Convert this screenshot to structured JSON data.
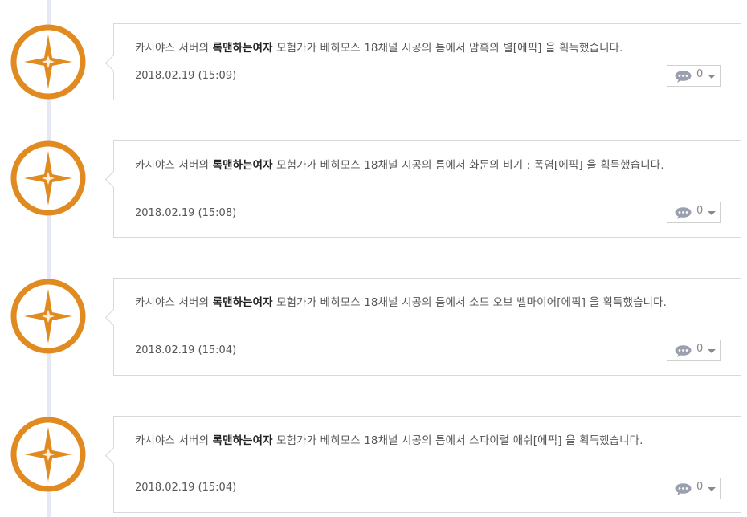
{
  "colors": {
    "badge_ring": "#e08a20",
    "badge_star": "#e08a20",
    "timeline": "#e6e8f6",
    "bubble": "#9aa0ad"
  },
  "entries": [
    {
      "msg_prefix": "카시야스 서버의 ",
      "player": "록맨하는여자",
      "msg_suffix": " 모험가가 베히모스 18채널 시공의 틈에서 암흑의 별[에픽] 을 획득했습니다.",
      "date": "2018.02.19 (15:09)",
      "comment_count": "0",
      "badge_icon": "star-compass-icon"
    },
    {
      "msg_prefix": "카시야스 서버의 ",
      "player": "록맨하는여자",
      "msg_suffix": " 모험가가 베히모스 18채널 시공의 틈에서 화둔의 비기 : 폭염[에픽] 을 획득했습니다.",
      "date": "2018.02.19 (15:08)",
      "comment_count": "0",
      "badge_icon": "star-compass-icon"
    },
    {
      "msg_prefix": "카시야스 서버의 ",
      "player": "록맨하는여자",
      "msg_suffix": " 모험가가 베히모스 18채널 시공의 틈에서 소드 오브 벨마이어[에픽] 을 획득했습니다.",
      "date": "2018.02.19 (15:04)",
      "comment_count": "0",
      "badge_icon": "star-compass-icon"
    },
    {
      "msg_prefix": "카시야스 서버의 ",
      "player": "록맨하는여자",
      "msg_suffix": " 모험가가 베히모스 18채널 시공의 틈에서 스파이럴 애쉬[에픽] 을 획득했습니다.",
      "date": "2018.02.19 (15:04)",
      "comment_count": "0",
      "badge_icon": "star-compass-icon"
    }
  ]
}
